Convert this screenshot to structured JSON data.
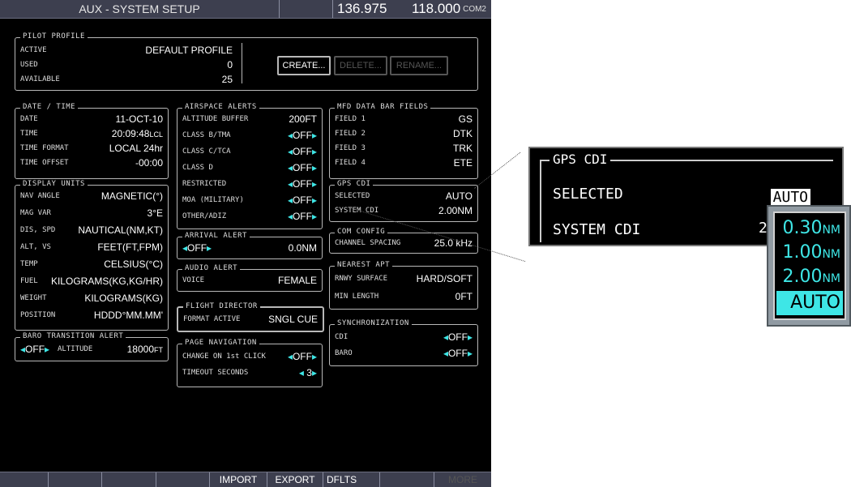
{
  "header": {
    "title": "AUX - SYSTEM SETUP",
    "freq_active": "136.975",
    "freq_standby": "118.000",
    "com_label": "COM2"
  },
  "pilot_profile": {
    "label": "PILOT PROFILE",
    "rows": [
      {
        "key": "ACTIVE",
        "value": "DEFAULT PROFILE"
      },
      {
        "key": "USED",
        "value": "0"
      },
      {
        "key": "AVAILABLE",
        "value": "25"
      }
    ],
    "buttons": {
      "create": "CREATE...",
      "delete": "DELETE...",
      "rename": "RENAME..."
    }
  },
  "date_time": {
    "label": "DATE / TIME",
    "rows": [
      {
        "key": "DATE",
        "value": "11-OCT-10"
      },
      {
        "key": "TIME",
        "value": "20:09:48",
        "unit": "LCL"
      },
      {
        "key": "TIME FORMAT",
        "value": "LOCAL 24hr"
      },
      {
        "key": "TIME OFFSET",
        "value": "-00:00"
      }
    ]
  },
  "display_units": {
    "label": "DISPLAY UNITS",
    "rows": [
      {
        "key": "NAV ANGLE",
        "value": "MAGNETIC(°)"
      },
      {
        "key": "MAG VAR",
        "value": "3°E"
      },
      {
        "key": "DIS, SPD",
        "value": "NAUTICAL(NM,KT)"
      },
      {
        "key": "ALT, VS",
        "value": "FEET(FT,FPM)"
      },
      {
        "key": "TEMP",
        "value": "CELSIUS(°C)"
      },
      {
        "key": "FUEL",
        "value": "KILOGRAMS(KG,KG/HR)"
      },
      {
        "key": "WEIGHT",
        "value": "KILOGRAMS(KG)"
      },
      {
        "key": "POSITION",
        "value": "HDDD°MM.MM'"
      }
    ]
  },
  "baro_transition": {
    "label": "BARO TRANSITION ALERT",
    "toggle": "OFF",
    "altitude_key": "ALTITUDE",
    "altitude_value": "18000",
    "altitude_unit": "FT"
  },
  "airspace_alerts": {
    "label": "AIRSPACE ALERTS",
    "rows": [
      {
        "key": "ALTITUDE BUFFER",
        "value": "200FT"
      },
      {
        "key": "CLASS B/TMA",
        "value": "OFF"
      },
      {
        "key": "CLASS C/TCA",
        "value": "OFF"
      },
      {
        "key": "CLASS D",
        "value": "OFF"
      },
      {
        "key": "RESTRICTED",
        "value": "OFF"
      },
      {
        "key": "MOA (MILITARY)",
        "value": "OFF"
      },
      {
        "key": "OTHER/ADIZ",
        "value": "OFF"
      }
    ]
  },
  "arrival_alert": {
    "label": "ARRIVAL ALERT",
    "toggle": "OFF",
    "value": "0.0NM"
  },
  "audio_alert": {
    "label": "AUDIO ALERT",
    "key": "VOICE",
    "value": "FEMALE"
  },
  "flight_director": {
    "label": "FLIGHT DIRECTOR",
    "key": "FORMAT ACTIVE",
    "value": "SNGL CUE"
  },
  "page_navigation": {
    "label": "PAGE NAVIGATION",
    "rows": [
      {
        "key": "CHANGE ON 1st CLICK",
        "value": "OFF"
      },
      {
        "key": "TIMEOUT SECONDS",
        "value": "3"
      }
    ]
  },
  "mfd_fields": {
    "label": "MFD DATA BAR FIELDS",
    "rows": [
      {
        "key": "FIELD 1",
        "value": "GS"
      },
      {
        "key": "FIELD 2",
        "value": "DTK"
      },
      {
        "key": "FIELD 3",
        "value": "TRK"
      },
      {
        "key": "FIELD 4",
        "value": "ETE"
      }
    ]
  },
  "gps_cdi": {
    "label": "GPS CDI",
    "rows": [
      {
        "key": "SELECTED",
        "value": "AUTO"
      },
      {
        "key": "SYSTEM CDI",
        "value": "2.00NM"
      }
    ]
  },
  "com_config": {
    "label": "COM CONFIG",
    "key": "CHANNEL SPACING",
    "value": "25.0 kHz"
  },
  "nearest_apt": {
    "label": "NEAREST APT",
    "rows": [
      {
        "key": "RNWY SURFACE",
        "value": "HARD/SOFT"
      },
      {
        "key": "MIN LENGTH",
        "value": "0FT"
      }
    ]
  },
  "synchronization": {
    "label": "SYNCHRONIZATION",
    "rows": [
      {
        "key": "CDI",
        "value": "OFF"
      },
      {
        "key": "BARO",
        "value": "OFF"
      }
    ]
  },
  "softkeys": [
    "",
    "",
    "",
    "",
    "IMPORT",
    "EXPORT",
    "DFLTS",
    "",
    "",
    "",
    "",
    ""
  ],
  "softkey_dim": "MORE",
  "zoom": {
    "label": "GPS CDI",
    "selected_key": "SELECTED",
    "selected_value": "AUTO",
    "system_key": "SYSTEM CDI",
    "system_value_partial": "2"
  },
  "popup_options": [
    {
      "value": "0.30",
      "unit": "NM"
    },
    {
      "value": "1.00",
      "unit": "NM"
    },
    {
      "value": "2.00",
      "unit": "NM"
    },
    {
      "value": "AUTO",
      "unit": ""
    }
  ],
  "colors": {
    "cyan": "#3ee6e6",
    "screen_bg": "#000000",
    "bar_bg": "#3d3f4f"
  }
}
